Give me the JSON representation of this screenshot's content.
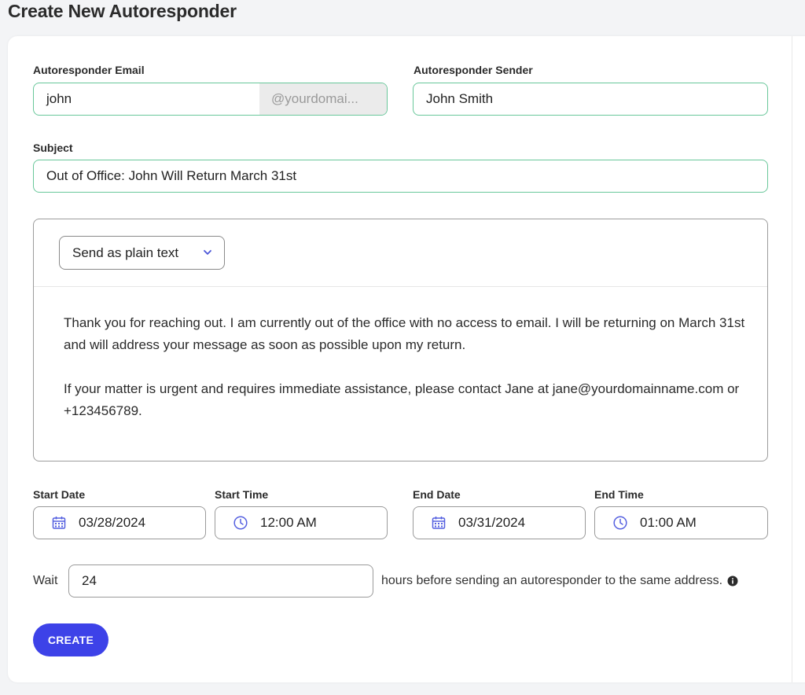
{
  "page": {
    "title": "Create New Autoresponder"
  },
  "form": {
    "email": {
      "label": "Autoresponder Email",
      "value": "john",
      "domain_suffix": "@yourdomai..."
    },
    "sender": {
      "label": "Autoresponder Sender",
      "value": "John Smith"
    },
    "subject": {
      "label": "Subject",
      "value": "Out of Office: John Will Return March 31st"
    },
    "editor": {
      "format_option": "Send as plain text",
      "paragraphs": [
        "Thank you for reaching out. I am currently out of the office with no access to email. I will be returning on March 31st and will address your message as soon as possible upon my return.",
        "If your matter is urgent and requires immediate assistance, please contact Jane at jane@yourdomainname.com or +123456789."
      ]
    },
    "start_date": {
      "label": "Start Date",
      "value": "03/28/2024"
    },
    "start_time": {
      "label": "Start Time",
      "value": "12:00 AM"
    },
    "end_date": {
      "label": "End Date",
      "value": "03/31/2024"
    },
    "end_time": {
      "label": "End Time",
      "value": "01:00 AM"
    },
    "wait": {
      "label": "Wait",
      "value": "24",
      "suffix": "hours before sending an autoresponder to the same address."
    },
    "create_label": "CREATE"
  },
  "colors": {
    "accent": "#3d42e8",
    "field_border_active": "#69c79a",
    "icon": "#5560e0"
  }
}
